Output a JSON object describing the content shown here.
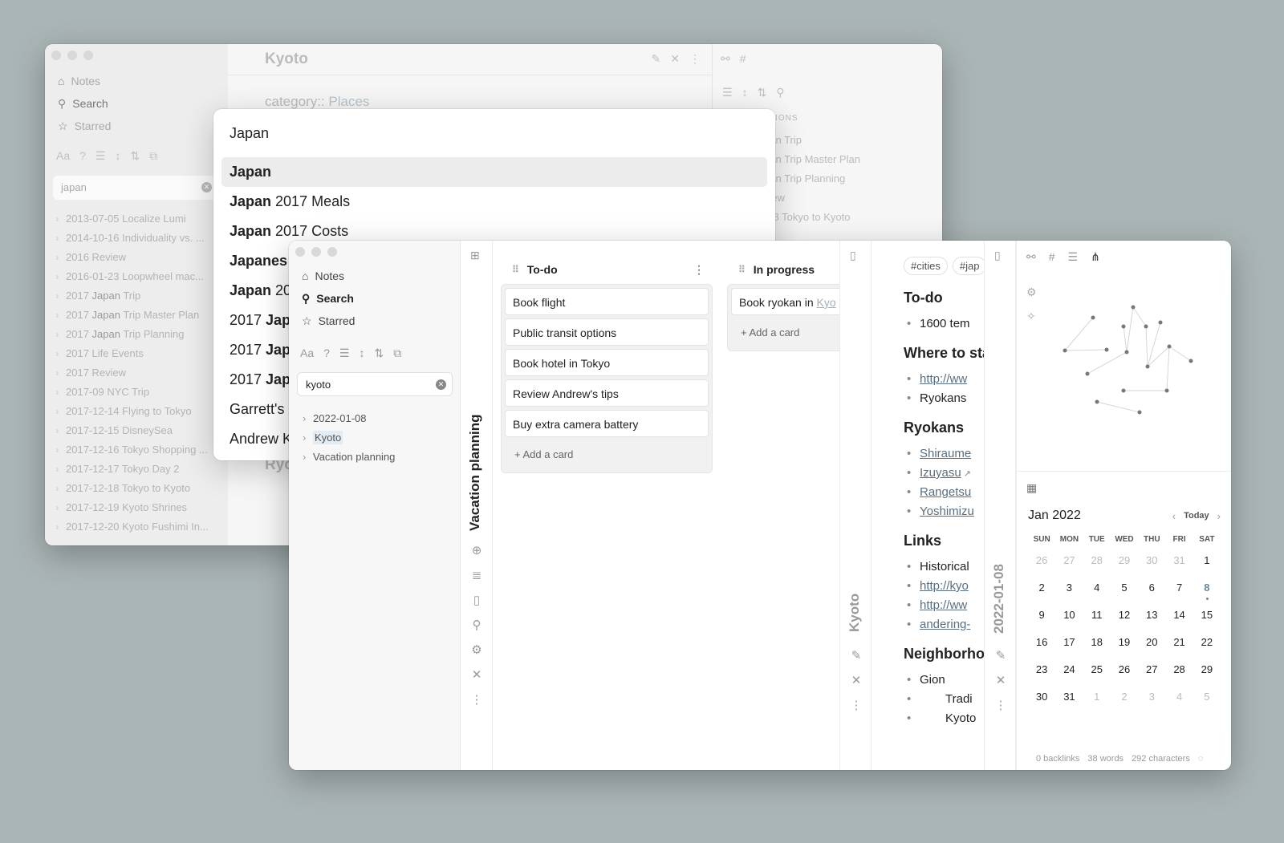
{
  "back_window": {
    "title": "Kyoto",
    "category_key": "category::",
    "category_value": "Places",
    "section_heading": "Ryo",
    "nav": [
      "Notes",
      "Search",
      "Starred"
    ],
    "search_value": "japan",
    "results": [
      {
        "pre": "2013-07-05 Localize Lumi",
        "hit": "",
        "post": ""
      },
      {
        "pre": "2014-10-16 Individuality vs. ...",
        "hit": "",
        "post": ""
      },
      {
        "pre": "2016 Review",
        "hit": "",
        "post": ""
      },
      {
        "pre": "2016-01-23 Loopwheel mac...",
        "hit": "",
        "post": ""
      },
      {
        "pre": "2017 ",
        "hit": "Japan",
        "post": " Trip"
      },
      {
        "pre": "2017 ",
        "hit": "Japan",
        "post": " Trip Master Plan"
      },
      {
        "pre": "2017 ",
        "hit": "Japan",
        "post": " Trip Planning"
      },
      {
        "pre": "2017 Life Events",
        "hit": "",
        "post": ""
      },
      {
        "pre": "2017 Review",
        "hit": "",
        "post": ""
      },
      {
        "pre": "2017-09 NYC Trip",
        "hit": "",
        "post": ""
      },
      {
        "pre": "2017-12-14 Flying to Tokyo",
        "hit": "",
        "post": ""
      },
      {
        "pre": "2017-12-15 DisneySea",
        "hit": "",
        "post": ""
      },
      {
        "pre": "2017-12-16 Tokyo Shopping ...",
        "hit": "",
        "post": ""
      },
      {
        "pre": "2017-12-17 Tokyo Day 2",
        "hit": "",
        "post": ""
      },
      {
        "pre": "2017-12-18 Tokyo to Kyoto",
        "hit": "",
        "post": ""
      },
      {
        "pre": "2017-12-19 Kyoto Shrines",
        "hit": "",
        "post": ""
      },
      {
        "pre": "2017-12-20 Kyoto Fushimi In...",
        "hit": "",
        "post": ""
      }
    ],
    "right_heading": "ATIONS",
    "right_items": [
      "pan Trip",
      "pan Trip Master Plan",
      "pan Trip Planning",
      "view",
      "-18 Tokyo to Kyoto"
    ]
  },
  "modal": {
    "query": "Japan",
    "results": [
      {
        "hit": "Japan",
        "post": ""
      },
      {
        "hit": "Japan",
        "post": " 2017 Meals"
      },
      {
        "hit": "Japan",
        "post": " 2017 Costs"
      },
      {
        "hit": "Japanes",
        "post": ""
      },
      {
        "hit": "Japan",
        "post": " 20"
      },
      {
        "pre": "2017 ",
        "hit": "Jap",
        "post": ""
      },
      {
        "pre": "2017 ",
        "hit": "Jap",
        "post": ""
      },
      {
        "pre": "2017 ",
        "hit": "Jap",
        "post": ""
      },
      {
        "pre": "Garrett's",
        "hit": "",
        "post": ""
      },
      {
        "pre": "Andrew K",
        "hit": "",
        "post": ""
      }
    ]
  },
  "front_window": {
    "nav": [
      "Notes",
      "Search",
      "Starred"
    ],
    "search_value": "kyoto",
    "tree": [
      "2022-01-08",
      "Kyoto",
      "Vacation planning"
    ],
    "board_title": "Vacation planning",
    "columns": [
      {
        "title": "To-do",
        "cards": [
          "Book flight",
          "Public transit options",
          "Book hotel in Tokyo",
          "Review Andrew's tips",
          "Buy extra camera battery"
        ],
        "add": "+ Add a card"
      },
      {
        "title": "In progress",
        "card_text": "Book ryokan in",
        "card_link": "Kyo",
        "add": "+ Add a card"
      }
    ],
    "note_strip_title": "Kyoto",
    "note": {
      "tags": [
        "#cities",
        "#jap"
      ],
      "h_todo": "To-do",
      "todo_item": "1600 tem",
      "h_where": "Where to sta",
      "where_link": "http://ww",
      "where_item": "Ryokans",
      "h_ryokans": "Ryokans",
      "ryokans": [
        "Shiraume",
        "Izuyasu",
        "Rangetsu",
        "Yoshimizu"
      ],
      "h_links": "Links",
      "links_item": "Historical",
      "links_a": "http://kyo",
      "links_b": "http://ww",
      "links_c": "andering-",
      "h_neighborhoods": "Neighborho",
      "gion": "Gion",
      "sub_a": "Tradi",
      "sub_b": "Kyoto"
    },
    "daily_strip_title": "2022-01-08",
    "calendar": {
      "month": "Jan 2022",
      "today_label": "Today",
      "days_header": [
        "SUN",
        "MON",
        "TUE",
        "WED",
        "THU",
        "FRI",
        "SAT"
      ],
      "weeks": [
        [
          "26",
          "27",
          "28",
          "29",
          "30",
          "31",
          "1"
        ],
        [
          "2",
          "3",
          "4",
          "5",
          "6",
          "7",
          "8"
        ],
        [
          "9",
          "10",
          "11",
          "12",
          "13",
          "14",
          "15"
        ],
        [
          "16",
          "17",
          "18",
          "19",
          "20",
          "21",
          "22"
        ],
        [
          "23",
          "24",
          "25",
          "26",
          "27",
          "28",
          "29"
        ],
        [
          "30",
          "31",
          "1",
          "2",
          "3",
          "4",
          "5"
        ]
      ],
      "today": "8"
    },
    "stats": {
      "backlinks": "0 backlinks",
      "words": "38 words",
      "characters": "292 characters"
    }
  }
}
